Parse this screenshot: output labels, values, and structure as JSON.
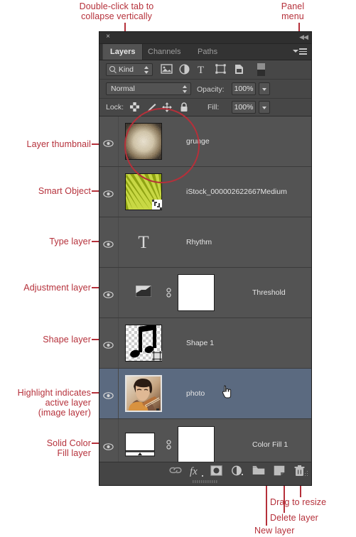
{
  "panel": {
    "close_label": "×",
    "collapse_label": "◀◀",
    "tabs": [
      {
        "label": "Layers",
        "active": true
      },
      {
        "label": "Channels",
        "active": false
      },
      {
        "label": "Paths",
        "active": false
      }
    ],
    "panel_menu_name": "panel-menu"
  },
  "filter_bar": {
    "kind_label": "Kind",
    "icons": [
      {
        "name": "filter-pixel-layers-icon",
        "glyph": "image"
      },
      {
        "name": "filter-adjustment-layers-icon",
        "glyph": "adjust"
      },
      {
        "name": "filter-type-layers-icon",
        "glyph": "T"
      },
      {
        "name": "filter-shape-layers-icon",
        "glyph": "shape"
      },
      {
        "name": "filter-smart-objects-icon",
        "glyph": "smart"
      }
    ],
    "toggle_name": "filter-enable-toggle"
  },
  "blend_bar": {
    "blend_mode": "Normal",
    "opacity_label": "Opacity:",
    "opacity_value": "100%"
  },
  "lock_bar": {
    "lock_label": "Lock:",
    "lock_buttons": [
      {
        "name": "lock-transparent-pixels-icon"
      },
      {
        "name": "lock-image-pixels-icon"
      },
      {
        "name": "lock-position-icon"
      },
      {
        "name": "lock-all-icon"
      }
    ],
    "fill_label": "Fill:",
    "fill_value": "100%"
  },
  "layers": [
    {
      "name": "grunge",
      "type": "image",
      "visible": true,
      "selected": false,
      "thumb": "grunge-texture",
      "has_mask": false,
      "has_link": false,
      "badge": null
    },
    {
      "name": "iStock_000002622667Medium",
      "type": "smart-object",
      "visible": true,
      "selected": false,
      "thumb": "green-sunburst",
      "has_mask": false,
      "has_link": false,
      "badge": "smart-object-badge"
    },
    {
      "name": "Rhythm",
      "type": "type",
      "visible": true,
      "selected": false,
      "thumb": "type-T",
      "has_mask": false,
      "has_link": false,
      "badge": null
    },
    {
      "name": "Threshold",
      "type": "adjustment",
      "visible": true,
      "selected": false,
      "thumb": "threshold-adjustment",
      "has_mask": true,
      "has_link": true,
      "badge": null
    },
    {
      "name": "Shape 1",
      "type": "shape",
      "visible": true,
      "selected": false,
      "thumb": "music-note-shape",
      "has_mask": false,
      "has_link": false,
      "badge": "vector-mask-badge"
    },
    {
      "name": "photo",
      "type": "image",
      "visible": true,
      "selected": true,
      "thumb": "boy-with-guitar-photo",
      "has_mask": false,
      "has_link": false,
      "badge": null
    },
    {
      "name": "Color Fill 1",
      "type": "solid-color-fill",
      "visible": true,
      "selected": false,
      "thumb": "solid-color-swatch",
      "has_mask": true,
      "has_link": true,
      "badge": null
    }
  ],
  "bottom_bar": {
    "buttons": [
      {
        "name": "link-layers-button",
        "glyph": "link"
      },
      {
        "name": "layer-style-button",
        "glyph": "fx"
      },
      {
        "name": "add-layer-mask-button",
        "glyph": "mask"
      },
      {
        "name": "new-fill-adjustment-layer-button",
        "glyph": "adjust"
      },
      {
        "name": "new-group-button",
        "glyph": "folder"
      },
      {
        "name": "new-layer-button",
        "glyph": "new"
      },
      {
        "name": "delete-layer-button",
        "glyph": "trash"
      }
    ]
  },
  "annotations": [
    {
      "id": "a-doubleclick",
      "text": "Double-click tab to\ncollapse vertically"
    },
    {
      "id": "a-panelmenu",
      "text": "Panel\nmenu"
    },
    {
      "id": "a-thumbnail",
      "text": "Layer thumbnail"
    },
    {
      "id": "a-smartobject",
      "text": "Smart Object"
    },
    {
      "id": "a-typelayer",
      "text": "Type layer"
    },
    {
      "id": "a-adjustment",
      "text": "Adjustment layer"
    },
    {
      "id": "a-shapelayer",
      "text": "Shape layer"
    },
    {
      "id": "a-highlight",
      "text": "Highlight indicates\nactive layer\n(image layer)"
    },
    {
      "id": "a-solidcolor",
      "text": "Solid Color\nFill layer"
    },
    {
      "id": "a-dragresize",
      "text": "Drag to resize"
    },
    {
      "id": "a-deletelayer",
      "text": "Delete layer"
    },
    {
      "id": "a-newlayer",
      "text": "New layer"
    }
  ],
  "colors": {
    "annotation_red": "#b5303a",
    "panel_bg": "#2b2b2b",
    "row_bg": "#535353",
    "row_selected": "#5b6a80",
    "toolbar_bg": "#474747"
  }
}
